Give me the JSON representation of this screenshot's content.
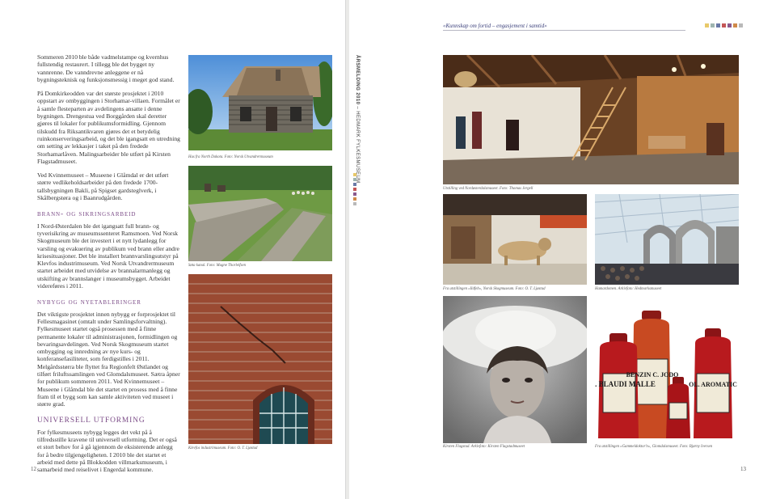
{
  "left_page": {
    "folio": "12",
    "intro_paragraphs": [
      "Sommeren 2010 ble både vadmelstampe og kvernhus fullstendig restaurert. I tillegg ble det bygget ny vannrenne. De vanndrevne anleggene er nå bygningsteknisk og funksjonsmessig i meget god stand.",
      "På Domkirkeodden var det største prosjektet i 2010 oppstart av ombyggingen i Storhamar-villaen. Formålet er å samle flesteparten av avdelingens ansatte i denne bygningen. Drengestua ved Borggården skal deretter gjøres til lokaler for publikumsformidling. Gjennom tilskudd fra Riksantikvaren gjøres det et betydelig ruinkonserveringsarbeid, og det ble igangsatt en utredning om setting av lekkasjer i taket på den fredede Storhamarlåven. Malingsarbeider ble utført på Kirsten Flagstadmuseet.",
      "Ved Kvinnemuseet – Museene i Glåmdal er det utført større vedlikeholdsarbeider på den fredede 1700-tallsbygningen Bakli, på Spigset gardsteglverk, i Skålbergstøra og i Baanrudgården."
    ],
    "sections": [
      {
        "heading": "Brann- og sikringsarbeid",
        "paragraphs": [
          "I Nord-Østerdalen ble det igangsatt full brann- og tyverisikring av museumssenteret Ramsmoen. Ved Norsk Skogmuseum ble det investert i et nytt lydanlegg for varsling og evakuering av publikum ved brann eller andre krisesituasjoner. Det ble installert brannvarslingsutstyr på Klevfos industrimuseum. Ved Norsk Utvandrermuseum startet arbeidet med utvidelse av brannalarmanlegg og utskifting av brannslanger i museumsbygget. Arbeidet videreføres i 2011."
        ]
      },
      {
        "heading": "Nybygg og nyetableringer",
        "paragraphs": [
          "Det viktigste prosjektet innen nybygg er forprosjektet til Fellesmagasinet (omtalt under Samlingsforvaltning). Fylkesmuseet startet også prosessen med å finne permanente lokaler til administrasjonen, formidlingen og bevaringsavdelingen. Ved Norsk Skogmuseum startet ombygging og innredning av nye kurs- og konferansefasiliteter, som ferdigstilles i 2011. Melgårdsstørra ble flyttet fra Regionfelt Østlandet og tilført friluftssamlingen ved Glomdalsmuseet. Sætra åpner for publikum sommeren 2011. Ved Kvinnemuseet – Museene i Glåmdal ble det startet en prosess med å finne fram til et bygg som kan samle aktiviteten ved museet i større grad."
        ]
      },
      {
        "heading": "Universell utforming",
        "paragraphs": [
          "For fylkesmuseets nybygg legges det vekt på å tilfredsstille kravene til universell utforming. Det er også et stort behov for å gå igjennom de eksisterende anlegg for å bedre tilgjengeligheten. I 2010 ble det startet et arbeid med dette på Blokkodden villmarksmuseum, i samarbeid med reiselivet i Engerdal kommune."
        ]
      }
    ],
    "captions": {
      "photo1": "Hus fra North Dakota. Foto: Norsk Utvandrermuseum",
      "photo2": "Søta kanal. Foto: Magne Thorleifsen",
      "photo3": "Klevfos industrimuseum. Foto: O. T. Ljøstad"
    }
  },
  "spine": {
    "label_bold": "ÅRSMELDING 2010",
    "label_rest": " – HEDMARK FYLKESMUSEUM",
    "colors": [
      "#e8c96a",
      "#9fb5b0",
      "#6a7aa8",
      "#c45656",
      "#8a5a8e",
      "#d08a4a",
      "#b9b9b9"
    ]
  },
  "right_page": {
    "folio": "13",
    "header": "«Kunnskap om fortid – engasjement i samtid»",
    "header_colors": [
      "#e8c96a",
      "#9fb5b0",
      "#6a7aa8",
      "#c45656",
      "#8a5a8e",
      "#d08a4a",
      "#b9b9b9"
    ],
    "captions": {
      "photo1": "Utstilling ved Nordøsterdalsmuseet. Foto: Thomas Jergell",
      "photo2": "Fra utstillingen «Ildfeb», Norsk Skogmuseum. Foto: O. T. Ljøstad",
      "photo3": "Hamardomen. Arkivfoto: Hedmarksmuseet",
      "photo4": "Kirsten Flagstad. Arkivfoto: Kirsten Flagstadmuseet",
      "photo5": "Fra utstillingen «Gammeldoktor'n», Glomdalsmuseet. Foto: Bjørny Iversen"
    },
    "bottle_labels": [
      "PIL. BLAUDI MALLE",
      "BENZIN C. JODO",
      "OL. AROMATIC"
    ]
  }
}
